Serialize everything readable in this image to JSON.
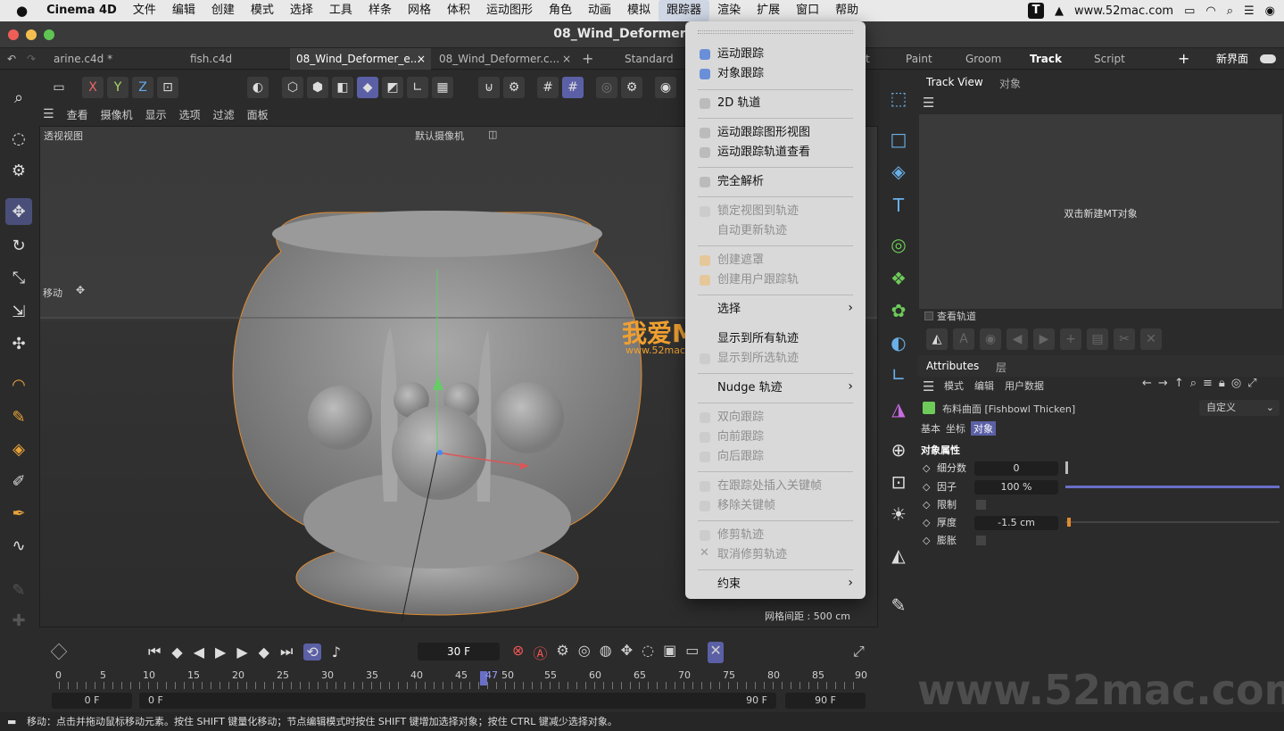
{
  "menubar": {
    "app": "Cinema 4D",
    "items": [
      "文件",
      "编辑",
      "创建",
      "模式",
      "选择",
      "工具",
      "样条",
      "网格",
      "体积",
      "运动图形",
      "角色",
      "动画",
      "模拟",
      "跟踪器",
      "渲染",
      "扩展",
      "窗口",
      "帮助"
    ],
    "url": "www.52mac.com"
  },
  "window": {
    "title": "08_Wind_Deformer_end.c"
  },
  "tabs": [
    "arine.c4d *",
    "fish.c4d",
    "08_Wind_Deformer_e...",
    "08_Wind_Deformer.c...",
    "Standard",
    "t",
    "Paint",
    "Groom",
    "Track",
    "Script"
  ],
  "new_layout": "新界面",
  "vpmenu": [
    "查看",
    "摄像机",
    "显示",
    "选项",
    "过滤",
    "面板"
  ],
  "viewport": {
    "view_name": "透视视图",
    "camera": "默认摄像机",
    "move_label": "移动",
    "grid_spacing": "网格间距 : 500 cm",
    "watermark_big": "我爱MAC",
    "watermark_small": "www.52mac.com"
  },
  "axis_labels": {
    "x": "X",
    "y": "Y",
    "z": "Z"
  },
  "tracker_menu": {
    "items": [
      {
        "label": "运动跟踪",
        "enabled": true
      },
      {
        "label": "对象跟踪",
        "enabled": true
      },
      {
        "label": "2D 轨道",
        "enabled": true
      },
      {
        "label": "运动跟踪图形视图",
        "enabled": true
      },
      {
        "label": "运动跟踪轨道查看",
        "enabled": true
      },
      {
        "label": "完全解析",
        "enabled": true
      },
      {
        "label": "锁定视图到轨迹",
        "enabled": false
      },
      {
        "label": "自动更新轨迹",
        "enabled": false
      },
      {
        "label": "创建遮罩",
        "enabled": false
      },
      {
        "label": "创建用户跟踪轨",
        "enabled": false
      },
      {
        "label": "选择",
        "enabled": true
      },
      {
        "label": "显示到所有轨迹",
        "enabled": true
      },
      {
        "label": "显示到所选轨迹",
        "enabled": false
      },
      {
        "label": "Nudge 轨迹",
        "enabled": true
      },
      {
        "label": "双向跟踪",
        "enabled": false
      },
      {
        "label": "向前跟踪",
        "enabled": false
      },
      {
        "label": "向后跟踪",
        "enabled": false
      },
      {
        "label": "在跟踪处插入关键帧",
        "enabled": false
      },
      {
        "label": "移除关键帧",
        "enabled": false
      },
      {
        "label": "修剪轨迹",
        "enabled": false
      },
      {
        "label": "取消修剪轨迹",
        "enabled": false
      },
      {
        "label": "约束",
        "enabled": true
      }
    ]
  },
  "timeline": {
    "current_frame": "30 F",
    "ticks": [
      "0",
      "5",
      "10",
      "15",
      "20",
      "25",
      "30",
      "35",
      "40",
      "45",
      "47",
      "50",
      "55",
      "60",
      "65",
      "70",
      "75",
      "80",
      "85",
      "90"
    ],
    "start": "0 F",
    "start2": "0 F",
    "end": "90 F",
    "end2": "90 F"
  },
  "status": "移动：点击并拖动鼠标移动元素。按住 SHIFT 键量化移动；节点编辑模式时按住 SHIFT 键增加选择对象；按住 CTRL 键减少选择对象。",
  "trackview": {
    "tab1": "Track View",
    "tab2": "对象",
    "empty_hint": "双击新建MT对象",
    "view_tracks": "查看轨道"
  },
  "attributes": {
    "tab1": "Attributes",
    "tab2": "层",
    "menu": [
      "模式",
      "编辑",
      "用户数据"
    ],
    "object": "布料曲面 [Fishbowl Thicken]",
    "preset": "自定义",
    "subtabs": [
      "基本",
      "坐标",
      "对象"
    ],
    "section": "对象属性",
    "fields": [
      {
        "label": "细分数",
        "value": "0"
      },
      {
        "label": "因子",
        "value": "100 %"
      },
      {
        "label": "限制",
        "value": ""
      },
      {
        "label": "厚度",
        "value": "-1.5 cm"
      },
      {
        "label": "膨胀",
        "value": ""
      }
    ]
  },
  "watermark": "www.52mac.com"
}
